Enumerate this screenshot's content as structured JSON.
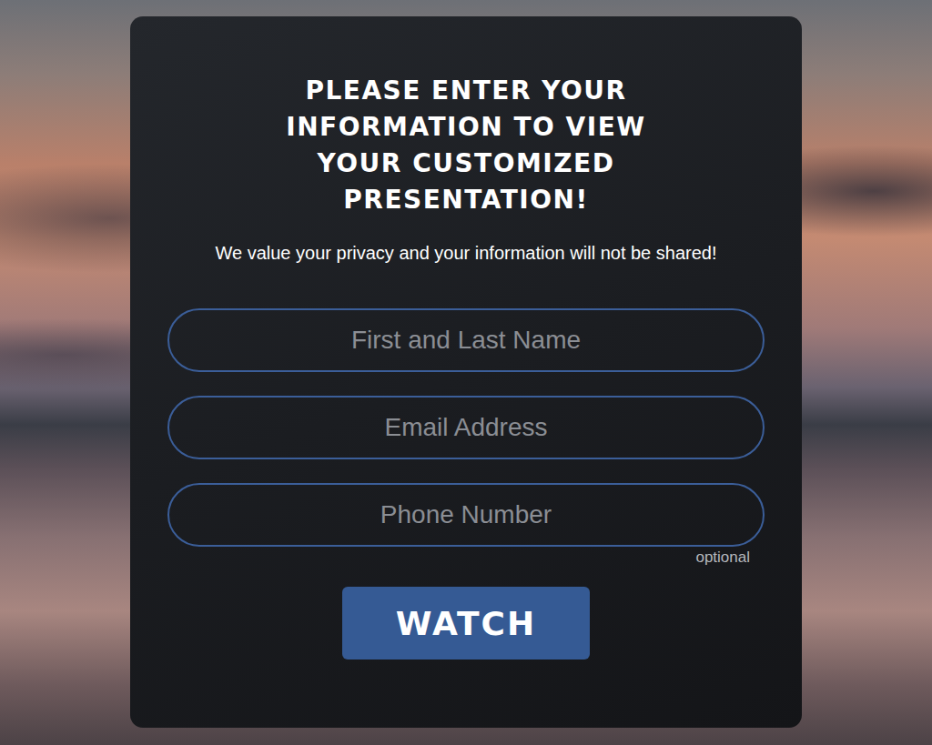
{
  "form": {
    "title": "PLEASE ENTER YOUR INFORMATION TO VIEW YOUR CUSTOMIZED PRESENTATION!",
    "privacy_note": "We value your privacy and your information will not be shared!",
    "fields": [
      {
        "placeholder": "First and Last Name"
      },
      {
        "placeholder": "Email Address"
      },
      {
        "placeholder": "Phone Number",
        "hint": "optional"
      }
    ],
    "button": "WATCH"
  }
}
